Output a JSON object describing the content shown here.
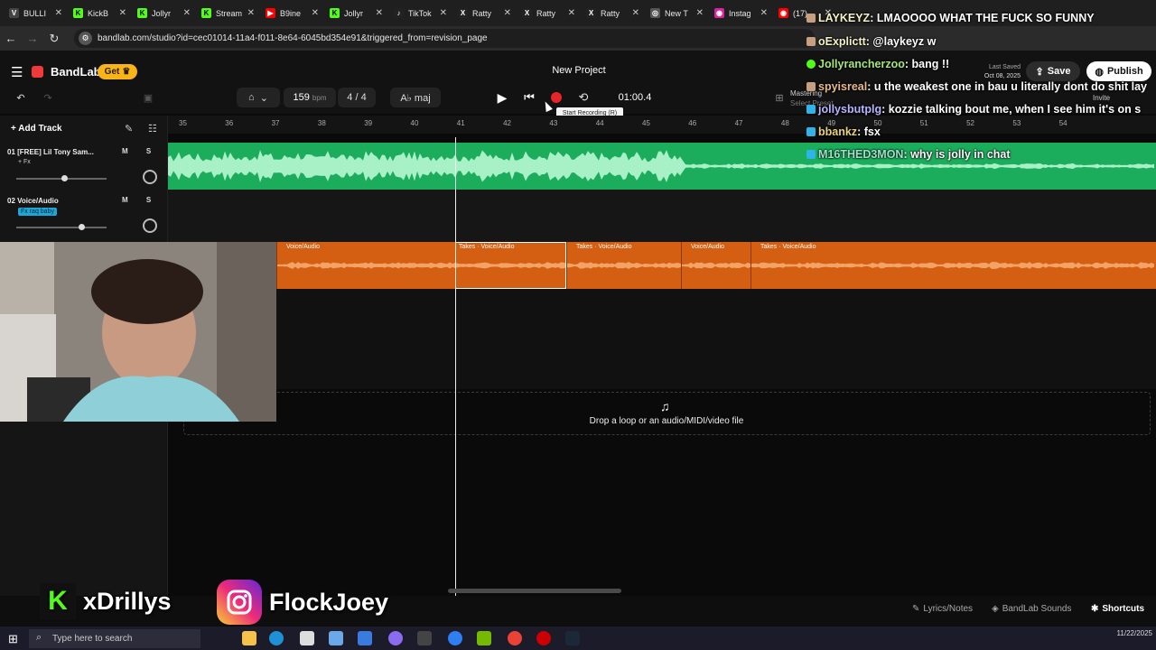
{
  "browser": {
    "tabs": [
      {
        "label": "BULLI",
        "color": "#444"
      },
      {
        "label": "KickB",
        "color": "#53fc18"
      },
      {
        "label": "Jollyr",
        "color": "#53fc18"
      },
      {
        "label": "Stream",
        "color": "#53fc18"
      },
      {
        "label": "B9ine",
        "color": "#ff0000"
      },
      {
        "label": "Jollyr",
        "color": "#53fc18"
      },
      {
        "label": "TikTok",
        "color": "#222"
      },
      {
        "label": "Ratty",
        "color": "#222"
      },
      {
        "label": "Ratty",
        "color": "#222"
      },
      {
        "label": "Ratty",
        "color": "#222"
      },
      {
        "label": "New T",
        "color": "#555"
      },
      {
        "label": "Instag",
        "color": "#d6249f"
      },
      {
        "label": "(17)",
        "color": "#ff0000"
      }
    ],
    "url": "bandlab.com/studio?id=cec01014-11a4-f011-8e64-6045bd354e91&triggered_from=revision_page"
  },
  "app": {
    "brand": "BandLab",
    "get_label": "Get",
    "project_title": "New Project",
    "last_saved": "Last Saved",
    "last_saved_date": "Oct 08, 2025",
    "save_label": "Save",
    "publish_label": "Publish",
    "mastering": "Mastering",
    "select_preset": "Select Preset",
    "invite": "Invite"
  },
  "transport": {
    "bpm": "159",
    "bpm_unit": "bpm",
    "time_signature": "4 / 4",
    "key": "A♭ maj",
    "time": "01:00.4",
    "tooltip": "Start Recording (R)"
  },
  "ruler": [
    "35",
    "36",
    "37",
    "38",
    "39",
    "40",
    "41",
    "42",
    "43",
    "44",
    "45",
    "46",
    "47",
    "48",
    "49",
    "50",
    "51",
    "52",
    "53",
    "54"
  ],
  "tracks": {
    "add_track": "Add Track",
    "t1_name": "01 [FREE] Lil Tony Sam...",
    "t1_fx": "+ Fx",
    "t2_name": "02 Voice/Audio",
    "t2_fx": "Fx raq baby",
    "ms": "M S"
  },
  "clips": [
    {
      "label": "Voice/Audio"
    },
    {
      "label": "Takes · Voice/Audio"
    },
    {
      "label": "Takes · Voice/Audio"
    },
    {
      "label": "Voice/Audio"
    },
    {
      "label": "Takes · Voice/Audio"
    }
  ],
  "drop_text": "Drop a loop or an audio/MIDI/video file",
  "chat": [
    {
      "user": "LAYKEYZ",
      "msg": ": LMAOOOO WHAT THE FUCK SO FUNNY"
    },
    {
      "user": "oExplictt",
      "msg": ": @laykeyz w"
    },
    {
      "user": "Jollyrancherzoo",
      "msg": ": bang !!"
    },
    {
      "user": "spyisreal",
      "msg": ": u the weakest one in bau u literally dont do shit lay"
    },
    {
      "user": "jollysbutplg",
      "msg": ": kozzie talking bout me, when I see him it's on s"
    },
    {
      "user": "bbankz",
      "msg": ": fsx"
    },
    {
      "user": "M16THED3MON",
      "msg": ": why is jolly in chat"
    }
  ],
  "bottom": {
    "lyrics": "Lyrics/Notes",
    "sounds": "BandLab Sounds",
    "shortcuts": "Shortcuts",
    "kick_handle": "xDrillys",
    "ig_handle": "FlockJoey"
  },
  "taskbar": {
    "search_placeholder": "Type here to search",
    "time": "11/22/2025"
  }
}
